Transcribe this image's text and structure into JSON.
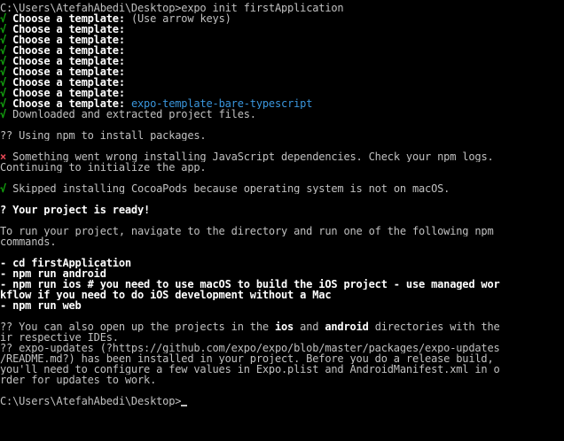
{
  "colors": {
    "background": "#000000",
    "text": "#c0c0c0",
    "bright": "#ffffff",
    "success": "#13a10e",
    "error": "#e74856",
    "highlight": "#3a96dd"
  },
  "command": {
    "prompt": "C:\\Users\\AtefahAbedi\\Desktop>",
    "text": "expo init firstApplication"
  },
  "template_prompt": {
    "check": "√",
    "label": " Choose a template:",
    "hint": " (Use arrow keys)",
    "selected": "expo-template-bare-typescript"
  },
  "downloaded": " Downloaded and extracted project files.",
  "npm_install": "?? Using npm to install packages.",
  "error_line": {
    "mark": "×",
    "text": " Something went wrong installing JavaScript dependencies. Check your npm logs."
  },
  "continuing": "Continuing to initialize the app.",
  "cocoapods": " Skipped installing CocoaPods because operating system is not on macOS.",
  "ready": "? Your project is ready!",
  "instructions": [
    "To run your project, navigate to the directory and run one of the following npm",
    "commands."
  ],
  "commands": [
    "- cd firstApplication",
    "- npm run android",
    "- npm run ios # you need to use macOS to build the iOS project - use managed wor",
    "kflow if you need to do iOS development without a Mac",
    "- npm run web"
  ],
  "ides": {
    "before": "?? You can also open up the projects in the ",
    "ios": "ios",
    "middle": " and ",
    "android": "android",
    "after": " directories with the",
    "wrap": "ir respective IDEs."
  },
  "updates": [
    "?? expo-updates (?https://github.com/expo/expo/blob/master/packages/expo-updates",
    "/README.md?) has been installed in your project. Before you do a release build,",
    "you'll need to configure a few values in Expo.plist and AndroidManifest.xml in o",
    "rder for updates to work."
  ],
  "final_prompt": "C:\\Users\\AtefahAbedi\\Desktop>"
}
